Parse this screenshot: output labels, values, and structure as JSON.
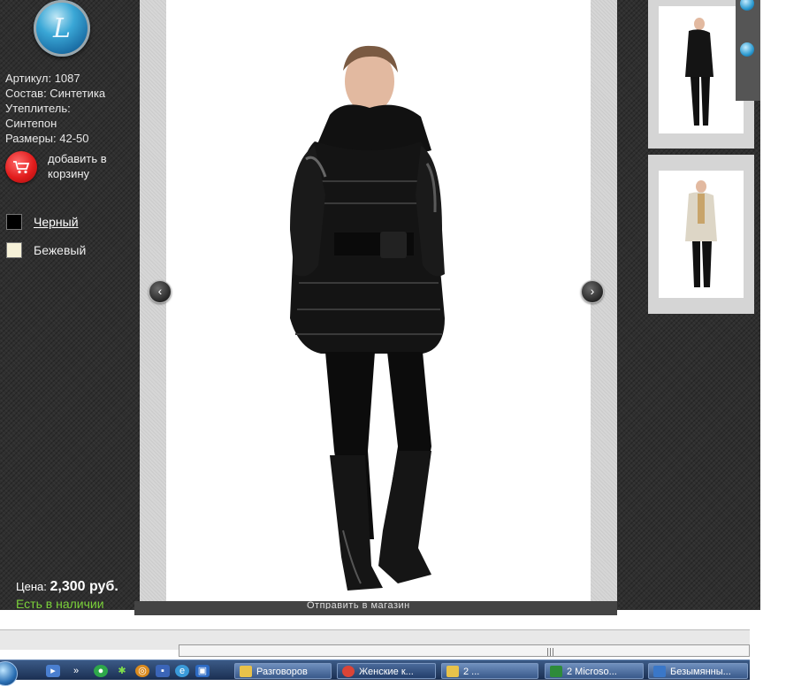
{
  "product": {
    "logo_letter": "L",
    "article": "Артикул: 1087",
    "composition": "Состав: Синтетика",
    "insulation_label": "Утеплитель:",
    "insulation_value": "Синтепон",
    "sizes": "Размеры: 42-50",
    "add_to_cart": "добавить в корзину",
    "price_label": "Цена:",
    "price_value": "2,300 руб.",
    "availability": "Есть в наличии"
  },
  "colors": [
    {
      "label": "Черный",
      "hex": "#000000",
      "selected": true
    },
    {
      "label": "Бежевый",
      "hex": "#f6f1d8",
      "selected": false
    }
  ],
  "gallery": {
    "prev_icon": "chevron-left-icon",
    "next_icon": "chevron-right-icon",
    "bottom_link": "Отправить в магазин",
    "thumbnails": [
      {
        "name": "black-coat-thumbnail"
      },
      {
        "name": "beige-coat-thumbnail"
      }
    ]
  },
  "browser": {
    "scroll_grip": "|||"
  },
  "taskbar": {
    "items": [
      {
        "label": "Разговоров",
        "color": "#e8c24a"
      },
      {
        "label": "Женские к...",
        "color": "#db4437"
      },
      {
        "label": "2 ...",
        "color": "#e8c24a"
      },
      {
        "label": "2 Microso...",
        "color": "#2e8b3a"
      },
      {
        "label": "Безымянны...",
        "color": "#3a77c8"
      }
    ]
  }
}
